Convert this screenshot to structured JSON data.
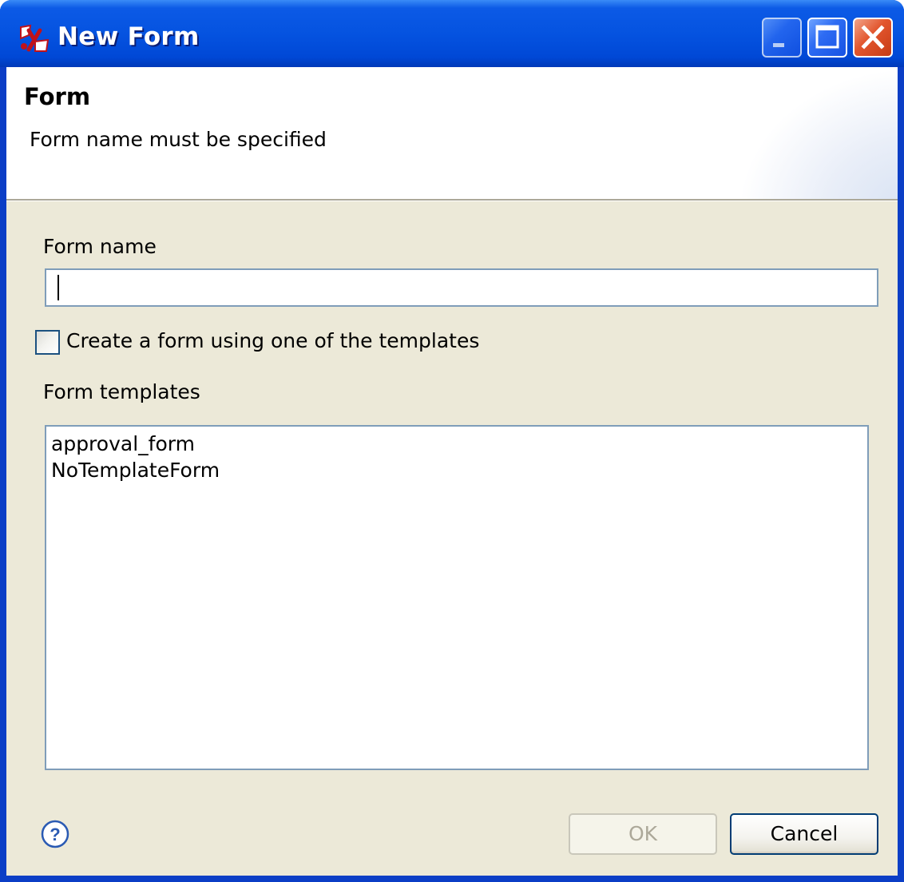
{
  "window": {
    "title": "New Form",
    "controls": [
      "minimize-icon",
      "maximize-icon",
      "close-icon"
    ]
  },
  "banner": {
    "title": "Form",
    "message": "Form name must be specified"
  },
  "form": {
    "name_label": "Form name",
    "name_value": "",
    "template_checkbox_label": "Create a form using one of the templates",
    "template_checkbox_checked": false,
    "templates_label": "Form templates",
    "templates": [
      "approval_form",
      "NoTemplateForm"
    ]
  },
  "footer": {
    "help_icon": "help-icon",
    "ok_label": "OK",
    "ok_enabled": false,
    "cancel_label": "Cancel"
  },
  "colors": {
    "titlebar": "#0553e0",
    "dialog_background": "#ece9d8",
    "input_border": "#7f9db9",
    "close_button": "#e2552d",
    "disabled_text": "#aca899"
  }
}
